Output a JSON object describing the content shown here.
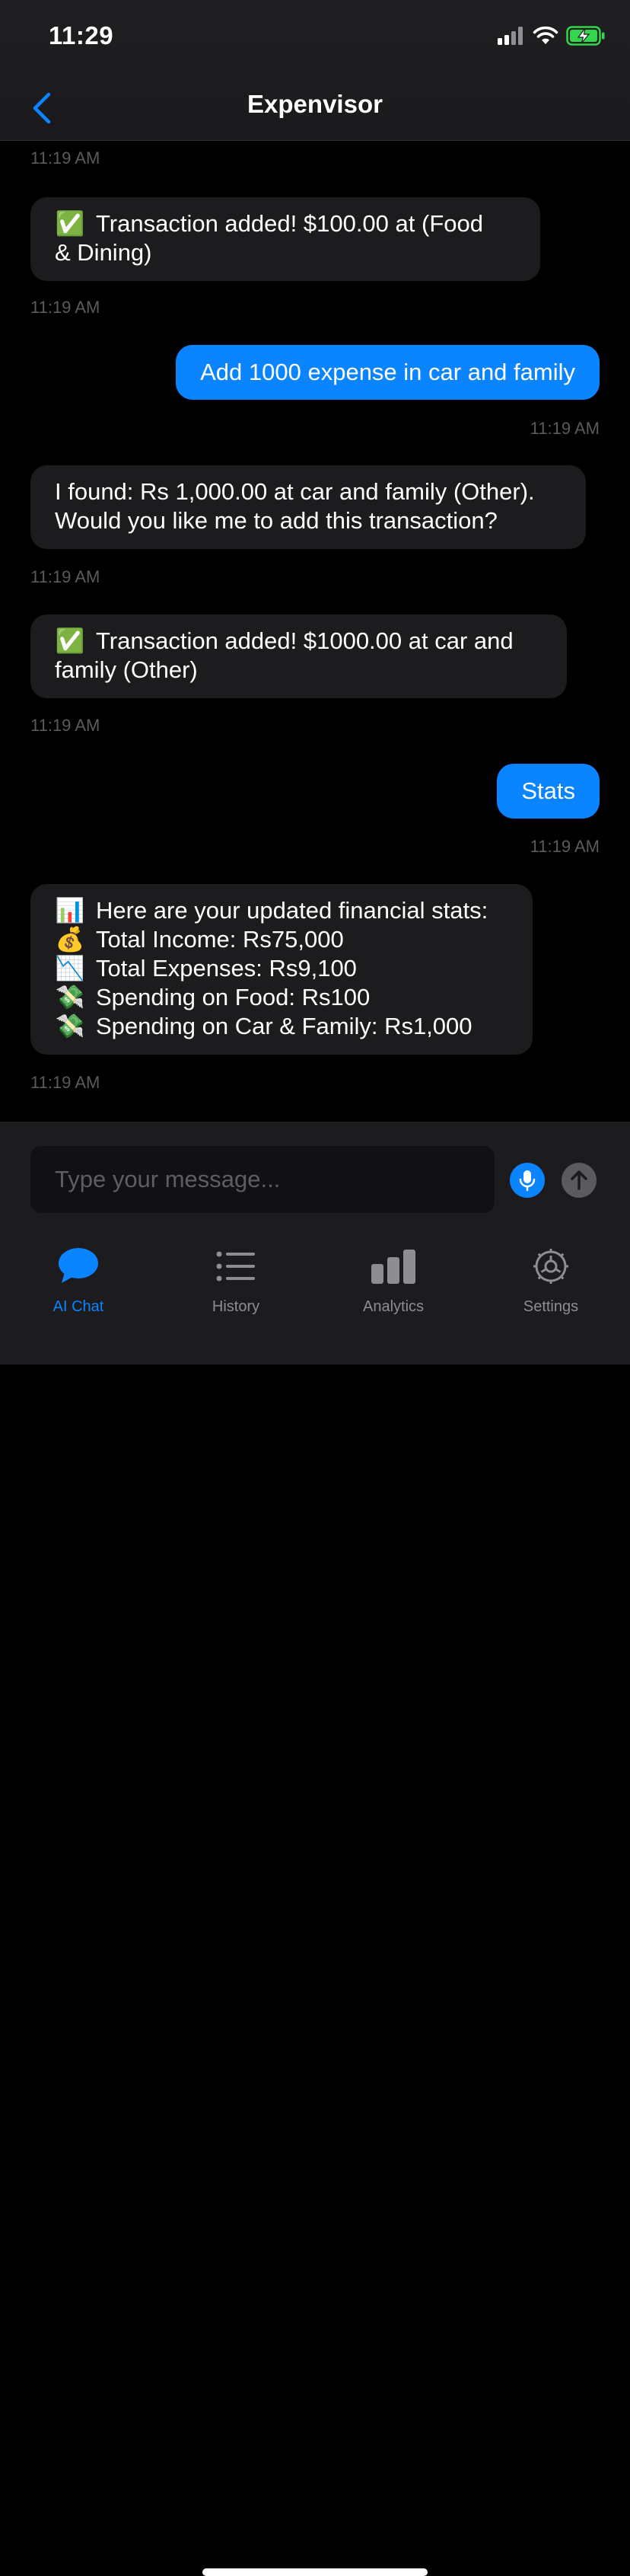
{
  "status_bar": {
    "time": "11:29",
    "icons": [
      "cellular-signal-icon",
      "wifi-icon",
      "battery-charging-icon"
    ],
    "battery_color": "#32d74b"
  },
  "nav": {
    "title": "Expenvisor",
    "back_icon": "chevron-left-icon"
  },
  "messages": [
    {
      "sender": "timestamp",
      "text": "11:19 AM"
    },
    {
      "sender": "ai",
      "lines": [
        {
          "emoji": "✅",
          "text": "Transaction added! $100.00 at  (Food"
        },
        {
          "emoji": "",
          "text": "& Dining)"
        }
      ]
    },
    {
      "sender": "timestamp",
      "text": "11:19 AM"
    },
    {
      "sender": "user",
      "text": "Add 1000 expense in car and family"
    },
    {
      "sender": "timestamp",
      "text": "11:19 AM"
    },
    {
      "sender": "ai",
      "lines": [
        {
          "emoji": "",
          "text": "I found: Rs 1,000.00 at car and family (Other)."
        },
        {
          "emoji": "",
          "text": "Would you like me to add this transaction?"
        }
      ]
    },
    {
      "sender": "timestamp",
      "text": "11:19 AM"
    },
    {
      "sender": "ai",
      "lines": [
        {
          "emoji": "✅",
          "text": "Transaction added! $1000.00 at car and"
        },
        {
          "emoji": "",
          "text": "family (Other)"
        }
      ]
    },
    {
      "sender": "timestamp",
      "text": "11:19 AM"
    },
    {
      "sender": "user",
      "text": "Stats"
    },
    {
      "sender": "timestamp",
      "text": "11:19 AM"
    },
    {
      "sender": "ai",
      "lines": [
        {
          "emoji": "📊",
          "text": "Here are your updated financial stats:"
        },
        {
          "emoji": "💰",
          "text": "Total Income: Rs75,000"
        },
        {
          "emoji": "📉",
          "text": "Total Expenses: Rs9,100"
        },
        {
          "emoji": "💸",
          "text": "Spending on Food: Rs100"
        },
        {
          "emoji": "💸",
          "text": "Spending on Car & Family: Rs1,000"
        }
      ]
    },
    {
      "sender": "timestamp",
      "text": "11:19 AM"
    }
  ],
  "composer": {
    "placeholder": "Type your message...",
    "mic_icon": "microphone-icon",
    "send_icon": "arrow-up-icon"
  },
  "tabs": [
    {
      "label": "AI Chat",
      "icon": "chat-bubble-icon",
      "active": true
    },
    {
      "label": "History",
      "icon": "list-icon",
      "active": false
    },
    {
      "label": "Analytics",
      "icon": "bar-chart-icon",
      "active": false
    },
    {
      "label": "Settings",
      "icon": "gear-icon",
      "active": false
    }
  ],
  "colors": {
    "accent": "#0a84ff",
    "background": "#000000",
    "ai_bubble": "#1c1c1e",
    "timestamp": "#5b5b5f"
  }
}
